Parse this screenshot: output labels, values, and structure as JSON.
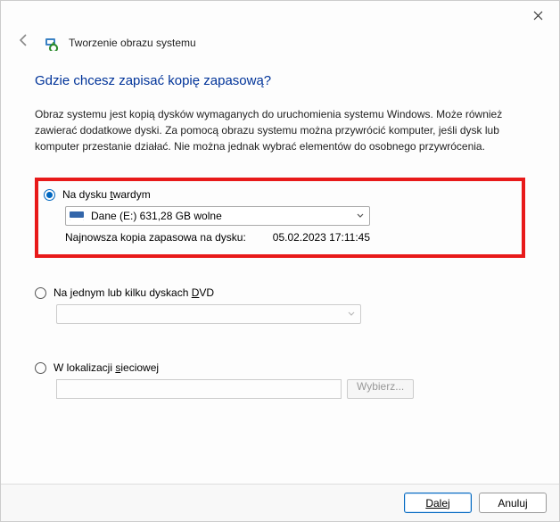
{
  "window": {
    "title": "Tworzenie obrazu systemu"
  },
  "heading": "Gdzie chcesz zapisać kopię zapasową?",
  "description": "Obraz systemu jest kopią dysków wymaganych do uruchomienia systemu Windows. Może również zawierać dodatkowe dyski. Za pomocą obrazu systemu można przywrócić komputer, jeśli dysk lub komputer przestanie działać. Nie można jednak wybrać elementów do osobnego przywrócenia.",
  "options": {
    "hdd": {
      "label_pre": "Na dysku ",
      "label_u": "t",
      "label_post": "wardym",
      "selected_drive": "Dane (E:)  631,28 GB wolne",
      "last_backup_label": "Najnowsza kopia zapasowa na dysku:",
      "last_backup_value": "05.02.2023 17:11:45"
    },
    "dvd": {
      "label_pre": "Na jednym lub kilku dyskach ",
      "label_u": "D",
      "label_post": "VD"
    },
    "network": {
      "label_pre": "W lokalizacji ",
      "label_u": "s",
      "label_post": "ieciowej",
      "browse": "Wybierz..."
    }
  },
  "footer": {
    "next": "Dalej",
    "cancel": "Anuluj"
  }
}
